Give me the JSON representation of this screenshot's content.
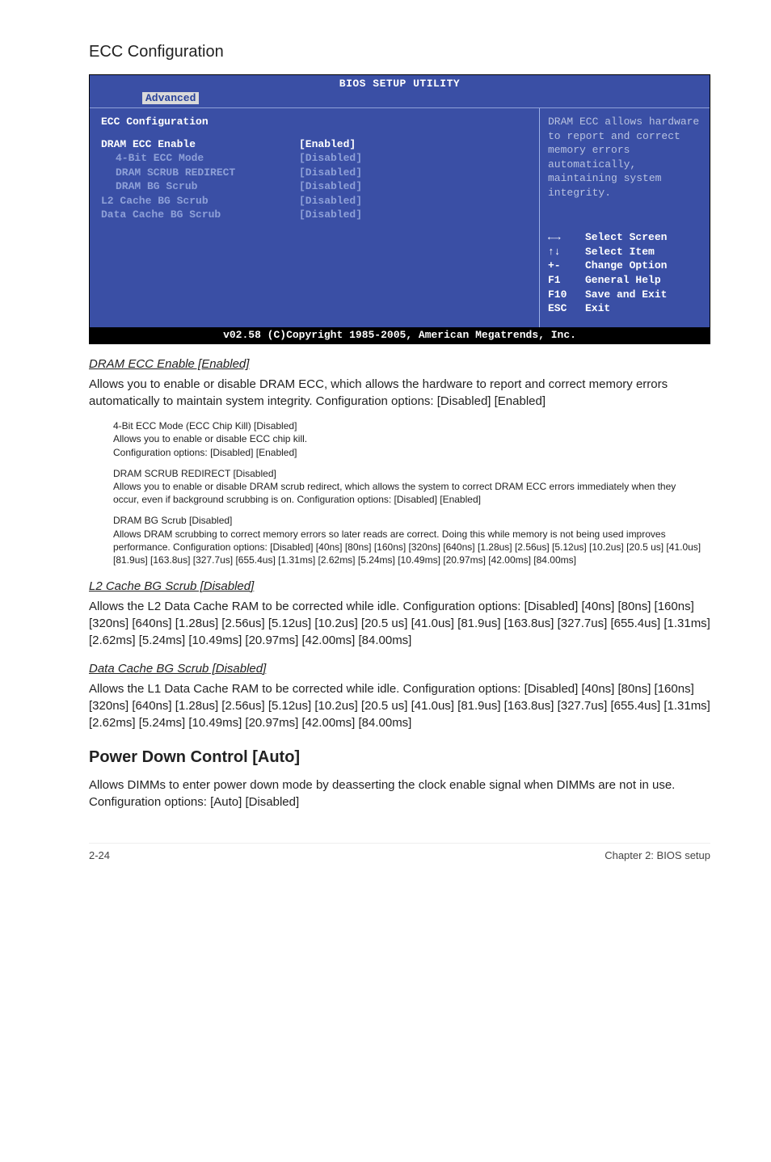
{
  "page": {
    "ecc_title": "ECC Configuration",
    "footer_left": "2-24",
    "footer_right": "Chapter 2: BIOS setup"
  },
  "bios": {
    "title": "BIOS SETUP UTILITY",
    "tab": "Advanced",
    "footer": "v02.58 (C)Copyright 1985-2005, American Megatrends, Inc.",
    "left": {
      "header": "ECC Configuration",
      "rows": [
        {
          "label": "DRAM ECC Enable",
          "value": "[Enabled]",
          "sub": false,
          "dim": false
        },
        {
          "label": "4-Bit ECC Mode",
          "value": "[Disabled]",
          "sub": true,
          "dim": true
        },
        {
          "label": "DRAM SCRUB REDIRECT",
          "value": "[Disabled]",
          "sub": true,
          "dim": true
        },
        {
          "label": "DRAM BG Scrub",
          "value": "[Disabled]",
          "sub": true,
          "dim": true
        },
        {
          "label": "L2 Cache BG Scrub",
          "value": "[Disabled]",
          "sub": false,
          "dim": true
        },
        {
          "label": "Data Cache BG Scrub",
          "value": "[Disabled]",
          "sub": false,
          "dim": true
        }
      ]
    },
    "right": {
      "desc": "DRAM ECC allows hardware to report and correct memory errors automatically, maintaining system integrity.",
      "help": [
        {
          "key": "←→",
          "text": "Select Screen"
        },
        {
          "key": "↑↓",
          "text": "Select Item"
        },
        {
          "key": "+-",
          "text": "Change Option"
        },
        {
          "key": "F1",
          "text": "General Help"
        },
        {
          "key": "F10",
          "text": "Save and Exit"
        },
        {
          "key": "ESC",
          "text": "Exit"
        }
      ]
    }
  },
  "items": {
    "dram_ecc": {
      "head": "DRAM ECC Enable [Enabled]",
      "body": "Allows you to enable or disable DRAM ECC, which allows the hardware to report and correct memory errors automatically to maintain system integrity. Configuration options: [Disabled] [Enabled]"
    },
    "inset1_l1": "4-Bit ECC Mode (ECC Chip Kill) [Disabled]",
    "inset1_l2": "Allows you to enable or disable ECC chip kill.",
    "inset1_l3": "Configuration options: [Disabled] [Enabled]",
    "inset2_l1": "DRAM SCRUB REDIRECT [Disabled]",
    "inset2_l2": "Allows you to enable or disable DRAM scrub redirect, which allows the system to correct DRAM ECC errors immediately when they occur, even if background scrubbing is on. Configuration options: [Disabled] [Enabled]",
    "inset3_l1": "DRAM BG Scrub [Disabled]",
    "inset3_l2": "Allows DRAM scrubbing to correct memory errors so later reads are correct. Doing this while memory is not being used improves performance. Configuration options: [Disabled] [40ns] [80ns] [160ns] [320ns] [640ns] [1.28us] [2.56us] [5.12us] [10.2us] [20.5 us] [41.0us] [81.9us] [163.8us] [327.7us] [655.4us] [1.31ms] [2.62ms] [5.24ms] [10.49ms] [20.97ms] [42.00ms] [84.00ms]",
    "l2cache": {
      "head": "L2 Cache BG Scrub [Disabled]",
      "body": "Allows the L2 Data Cache RAM to be corrected while idle. Configuration options: [Disabled] [40ns] [80ns] [160ns] [320ns] [640ns] [1.28us] [2.56us] [5.12us] [10.2us] [20.5 us] [41.0us] [81.9us] [163.8us] [327.7us] [655.4us] [1.31ms] [2.62ms] [5.24ms] [10.49ms] [20.97ms] [42.00ms] [84.00ms]"
    },
    "datacache": {
      "head": "Data Cache BG Scrub [Disabled]",
      "body": "Allows the L1 Data Cache RAM to be corrected while idle. Configuration options: [Disabled] [40ns] [80ns] [160ns] [320ns] [640ns] [1.28us] [2.56us] [5.12us] [10.2us] [20.5 us] [41.0us] [81.9us] [163.8us] [327.7us] [655.4us] [1.31ms] [2.62ms] [5.24ms] [10.49ms] [20.97ms] [42.00ms] [84.00ms]"
    }
  },
  "pdc": {
    "head": "Power Down Control [Auto]",
    "p1": "Allows DIMMs to enter power down mode by deasserting the clock enable signal when DIMMs are not in use.",
    "p2": "Configuration options: [Auto] [Disabled]"
  }
}
